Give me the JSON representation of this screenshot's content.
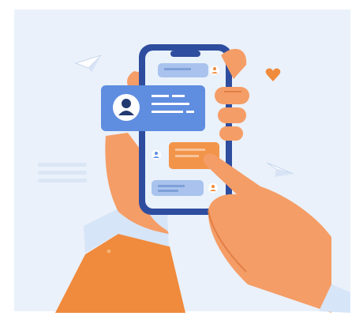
{
  "illustration": {
    "subject": "hands-holding-smartphone-chat",
    "colors": {
      "background": "#eaf1fa",
      "phone_frame": "#2e4d9f",
      "phone_screen": "#e9f1fb",
      "bubble_blue": "#a9c3ee",
      "bubble_orange": "#f2944a",
      "contact_card": "#5f8de0",
      "skin": "#f59d66",
      "skin_shadow": "#e07f46",
      "sleeve_light": "#d7e5f8",
      "sleeve_orange": "#f08a3c",
      "heart": "#f08a3c",
      "avatar_dark": "#233a70"
    },
    "icons": [
      "paper-plane-icon",
      "heart-icon",
      "user-avatar-icon",
      "paper-plane-icon"
    ]
  }
}
